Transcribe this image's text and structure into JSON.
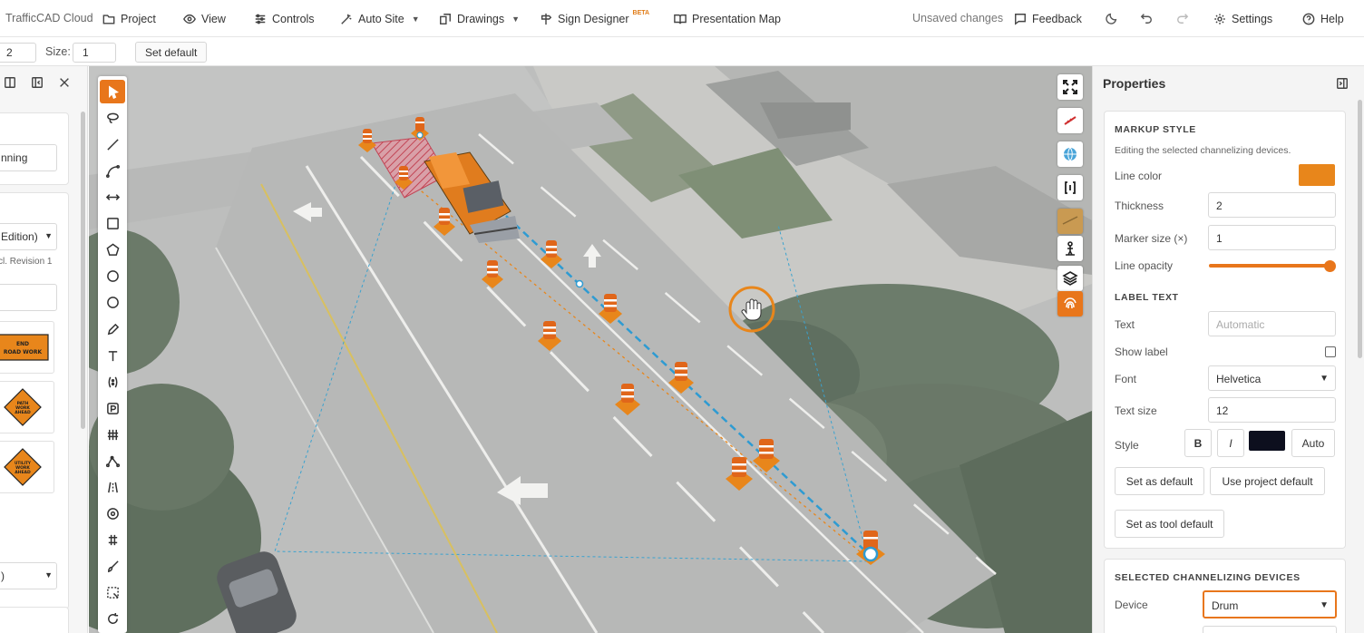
{
  "app": {
    "brand": "TrafficCAD Cloud",
    "menu": [
      {
        "label": "Project",
        "icon": "folder-icon"
      },
      {
        "label": "View",
        "icon": "eye-icon"
      },
      {
        "label": "Controls",
        "icon": "sliders-icon"
      },
      {
        "label": "Auto Site",
        "icon": "magic-wand-icon"
      },
      {
        "label": "Drawings",
        "icon": "drawings-icon"
      },
      {
        "label": "Sign Designer",
        "icon": "signpost-icon",
        "badge": "BETA"
      },
      {
        "label": "Presentation Map",
        "icon": "book-open-icon"
      }
    ],
    "status": "Unsaved changes",
    "feedback_label": "Feedback",
    "settings_label": "Settings",
    "help_label": "Help",
    "accent_color": "#e8761b"
  },
  "subbar": {
    "value1": "2",
    "size_label": "Size:",
    "size_value": "1",
    "set_default_label": "Set default"
  },
  "left_panel": {
    "field1": "nning",
    "select1": "Edition)",
    "note": "cl. Revision 1",
    "sign1_text": "END ROAD WORK",
    "sign2_text": "PATH WORK AHEAD",
    "sign3_text": "UTILITY WORK AHEAD",
    "select2": ")"
  },
  "properties": {
    "title": "Properties",
    "markup_style": {
      "heading": "MARKUP STYLE",
      "note": "Editing the selected channelizing devices.",
      "line_color_label": "Line color",
      "line_color": "#e8861b",
      "thickness_label": "Thickness",
      "thickness": "2",
      "marker_size_label": "Marker size (×)",
      "marker_size": "1",
      "line_opacity_label": "Line opacity",
      "line_opacity": 1.0
    },
    "label_text": {
      "heading": "LABEL TEXT",
      "text_label": "Text",
      "text_placeholder": "Automatic",
      "show_label": "Show label",
      "font_label": "Font",
      "font": "Helvetica",
      "text_size_label": "Text size",
      "text_size": "12",
      "style_label": "Style",
      "bold": "B",
      "italic": "I",
      "style_color": "#0d0f1e",
      "auto": "Auto",
      "set_as_default": "Set as default",
      "use_project_default": "Use project default",
      "set_as_tool_default": "Set as tool default"
    },
    "channelizing": {
      "heading": "SELECTED CHANNELIZING DEVICES",
      "device_label": "Device",
      "device": "Drum"
    }
  }
}
